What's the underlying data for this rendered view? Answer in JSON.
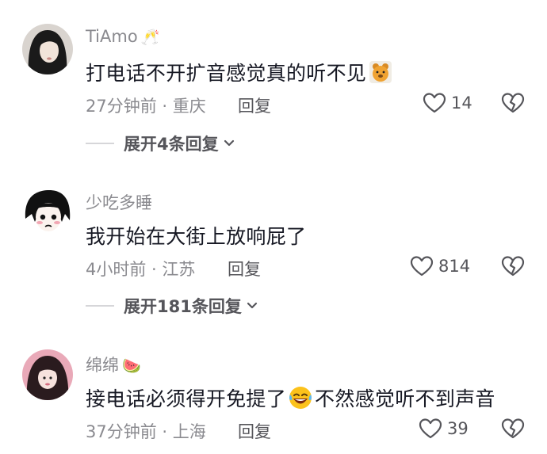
{
  "comments": [
    {
      "username": "TiAmo",
      "username_emoji": "🥂",
      "text": "打电话不开扩音感觉真的听不见",
      "inline_emoji": "bear-emoji",
      "text_after": "",
      "time": "27分钟前",
      "location": "重庆",
      "reply_label": "回复",
      "likes": "14",
      "expand_label": "展开4条回复"
    },
    {
      "username": "少吃多睡",
      "username_emoji": "",
      "text": "我开始在大街上放响屁了",
      "time": "4小时前",
      "location": "江苏",
      "reply_label": "回复",
      "likes": "814",
      "expand_label": "展开181条回复"
    },
    {
      "username": "绵绵",
      "username_emoji": "🍉",
      "text": "接电话必须得开免提了",
      "inline_emoji": "laughing-crying-emoji",
      "text_after": "不然感觉听不到声音",
      "time": "37分钟前",
      "location": "上海",
      "reply_label": "回复",
      "likes": "39"
    }
  ],
  "meta_separator": " · ",
  "colors": {
    "text": "#161823",
    "secondary": "#8a8a8f",
    "action": "#55555a"
  }
}
